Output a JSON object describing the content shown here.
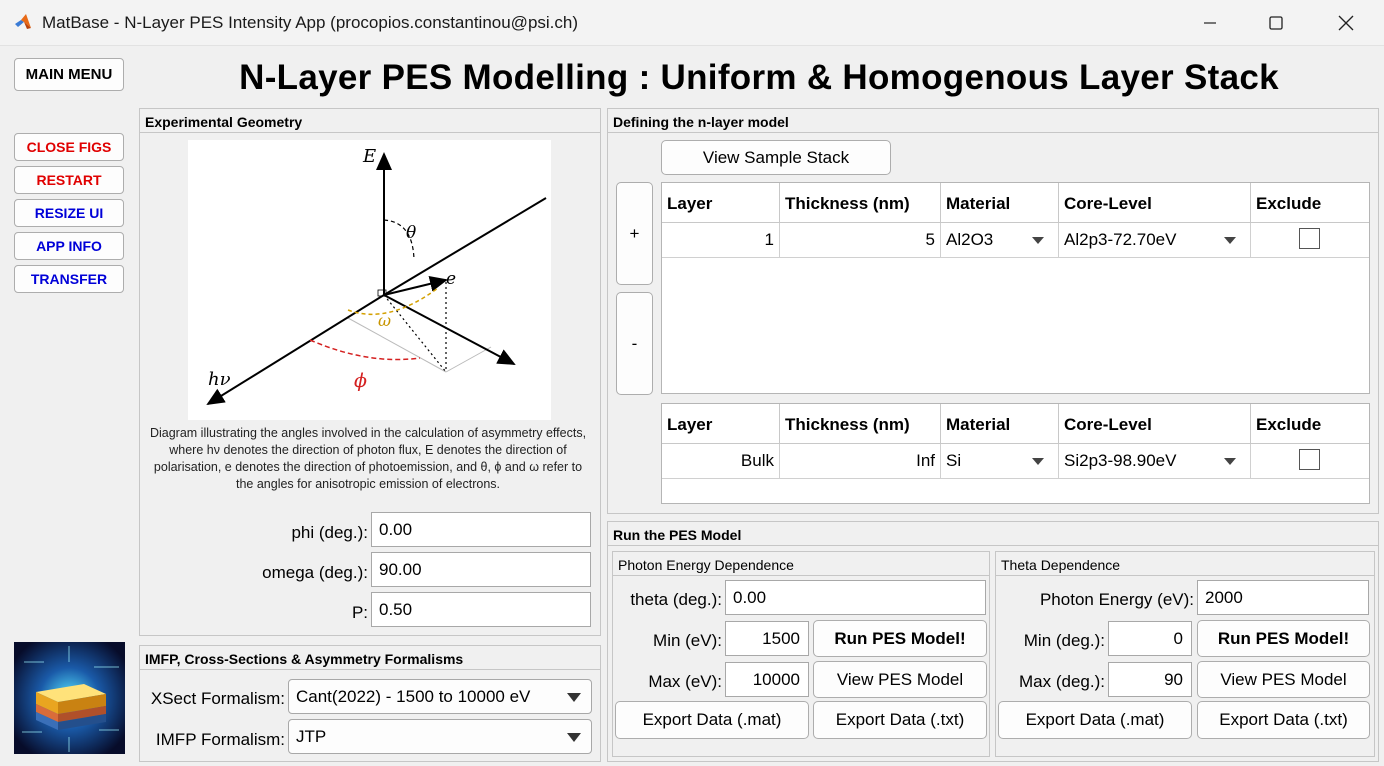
{
  "window": {
    "title": "MatBase - N-Layer PES Intensity App (procopios.constantinou@psi.ch)"
  },
  "sidebar": {
    "main_menu": "MAIN MENU",
    "close_figs": "CLOSE FIGS",
    "restart": "RESTART",
    "resize_ui": "RESIZE UI",
    "app_info": "APP INFO",
    "transfer": "TRANSFER"
  },
  "page_title": "N-Layer PES Modelling : Uniform & Homogenous Layer Stack",
  "geometry": {
    "title": "Experimental Geometry",
    "diagram_labels": {
      "E": "E",
      "theta": "θ",
      "e": "e",
      "omega": "ω",
      "hv": "hν",
      "phi": "ϕ"
    },
    "caption": "Diagram illustrating the angles involved in the calculation of asymmetry effects, where hν denotes the direction of photon flux, E denotes the direction of polarisation, e denotes the direction of photoemission, and θ, ϕ and ω refer to the angles for anisotropic emission of electrons.",
    "phi_label": "phi (deg.):",
    "phi_value": "0.00",
    "omega_label": "omega (deg.):",
    "omega_value": "90.00",
    "p_label": "P:",
    "p_value": "0.50"
  },
  "formalisms": {
    "title": "IMFP, Cross-Sections & Asymmetry Formalisms",
    "xsect_label": "XSect Formalism:",
    "xsect_value": "Cant(2022) - 1500 to 10000 eV",
    "imfp_label": "IMFP Formalism:",
    "imfp_value": "JTP"
  },
  "nlayer": {
    "title": "Defining the n-layer model",
    "view_stack": "View Sample Stack",
    "add": "+",
    "remove": "-",
    "headers": [
      "Layer",
      "Thickness (nm)",
      "Material",
      "Core-Level",
      "Exclude"
    ],
    "layers": [
      {
        "layer": "1",
        "thickness": "5",
        "material": "Al2O3",
        "core_level": "Al2p3-72.70eV"
      }
    ],
    "bulk": {
      "layer": "Bulk",
      "thickness": "Inf",
      "material": "Si",
      "core_level": "Si2p3-98.90eV"
    }
  },
  "run": {
    "title": "Run the PES Model",
    "photon": {
      "title": "Photon Energy Dependence",
      "theta_label": "theta (deg.):",
      "theta_value": "0.00",
      "min_label": "Min (eV):",
      "min_value": "1500",
      "max_label": "Max (eV):",
      "max_value": "10000",
      "run": "Run PES Model!",
      "view": "View PES Model",
      "export_mat": "Export Data (.mat)",
      "export_txt": "Export Data (.txt)"
    },
    "theta": {
      "title": "Theta Dependence",
      "energy_label": "Photon Energy (eV):",
      "energy_value": "2000",
      "min_label": "Min (deg.):",
      "min_value": "0",
      "max_label": "Max (deg.):",
      "max_value": "90",
      "run": "Run PES Model!",
      "view": "View PES Model",
      "export_mat": "Export Data (.mat)",
      "export_txt": "Export Data (.txt)"
    }
  },
  "icons": {
    "app": "matlab-icon",
    "minimize": "minimize-icon",
    "maximize": "maximize-icon",
    "close": "close-icon",
    "logo": "layer-stack-logo"
  }
}
